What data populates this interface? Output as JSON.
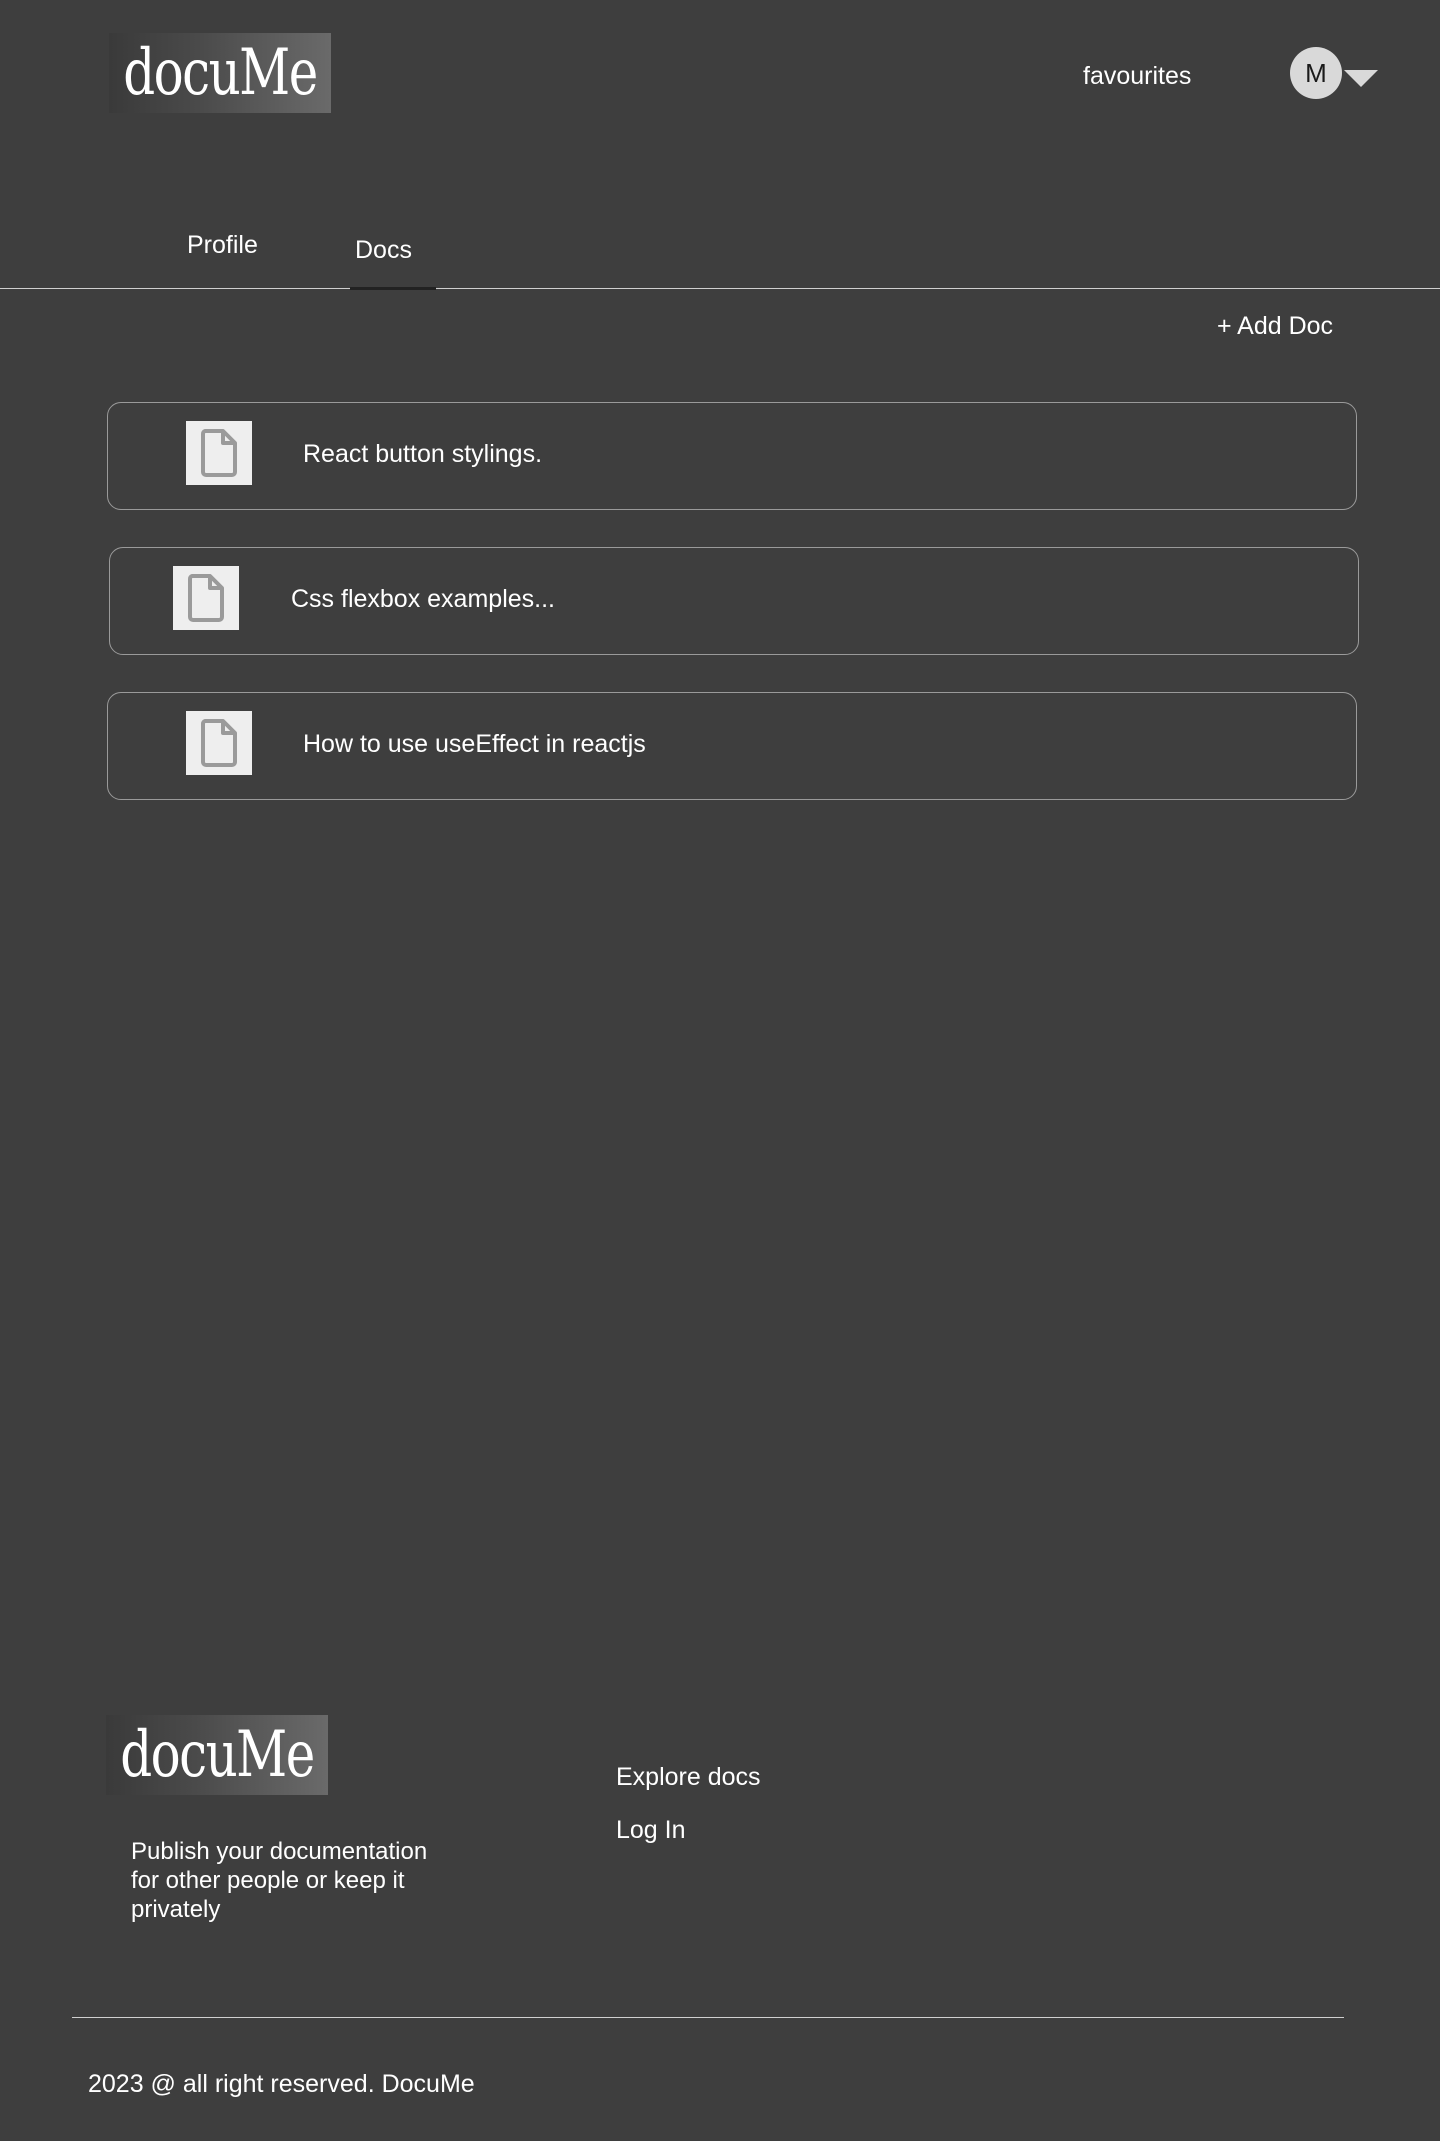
{
  "header": {
    "logo": "docuMe",
    "favourites_label": "favourites",
    "avatar_initial": "M"
  },
  "tabs": [
    {
      "label": "Profile",
      "active": false
    },
    {
      "label": "Docs",
      "active": true
    }
  ],
  "add_doc_label": "+ Add Doc",
  "docs": [
    {
      "title": "React button stylings.",
      "icon": "document-icon"
    },
    {
      "title": "Css flexbox examples...",
      "icon": "document-icon"
    },
    {
      "title": "How to use useEffect in reactjs",
      "icon": "document-icon"
    }
  ],
  "footer": {
    "logo": "docuMe",
    "tagline": "Publish your documentation for other people or keep it privately",
    "links": [
      "Explore docs",
      "Log In"
    ],
    "copyright": "2023 @ all right reserved. DocuMe"
  },
  "colors": {
    "background": "#3e3e3e",
    "text": "#ffffff",
    "card_border": "#9a9a9a",
    "avatar_bg": "#d9d9d9"
  }
}
